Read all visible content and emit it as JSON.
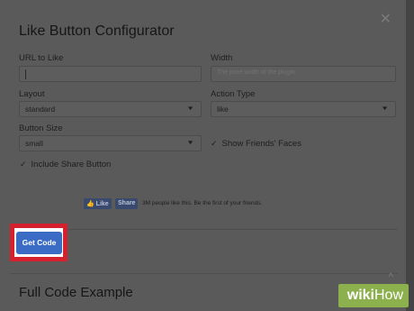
{
  "dialog": {
    "title": "Like Button Configurator",
    "close_icon": "close-icon"
  },
  "fields": {
    "url_label": "URL to Like",
    "url_placeholder": "",
    "width_label": "Width",
    "width_placeholder": "The pixel width of the plugin",
    "layout_label": "Layout",
    "layout_value": "standard",
    "action_label": "Action Type",
    "action_value": "like",
    "size_label": "Button Size",
    "size_value": "small",
    "show_faces_label": "Show Friends' Faces",
    "include_share_label": "Include Share Button"
  },
  "preview": {
    "like_label": "Like",
    "share_label": "Share",
    "text": "3M people like this. Be the first of your friends."
  },
  "actions": {
    "get_code_label": "Get Code"
  },
  "section": {
    "full_code_title": "Full Code Example"
  },
  "watermark": {
    "wiki": "wiki",
    "how": "How"
  },
  "colors": {
    "highlight": "#d5202e",
    "button": "#3a6cc6",
    "watermark_bg": "#8cb04d"
  }
}
